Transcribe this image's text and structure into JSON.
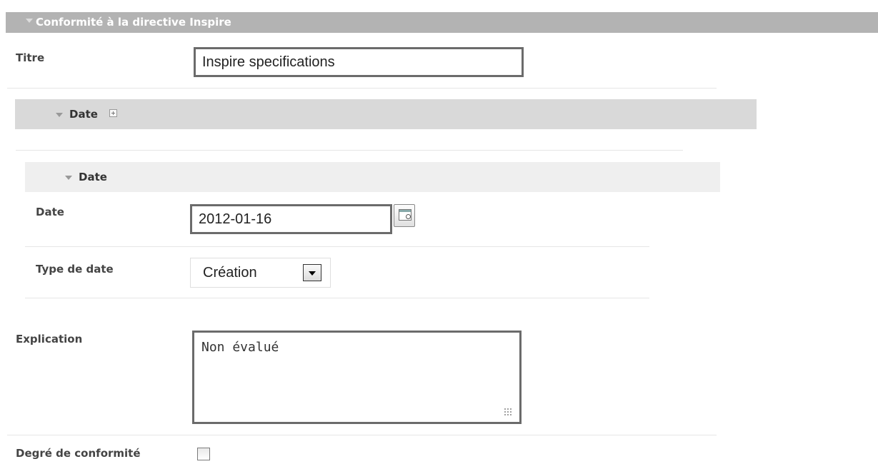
{
  "section": {
    "title": "Conformité à la directive Inspire"
  },
  "fields": {
    "titre": {
      "label": "Titre",
      "value": "Inspire specifications"
    },
    "date_group": {
      "label": "Date"
    },
    "date_item": {
      "label": "Date"
    },
    "date": {
      "label": "Date",
      "value": "2012-01-16"
    },
    "type_de_date": {
      "label": "Type de date",
      "value": "Création"
    },
    "explication": {
      "label": "Explication",
      "value": "Non évalué"
    },
    "degre": {
      "label": "Degré de conformité",
      "checked": false
    }
  },
  "colors": {
    "section_bar": "#b3b3b3",
    "subsection_bar": "#d9d9d9",
    "subsection_bar_light": "#efefef",
    "input_border": "#6b6b6b"
  },
  "icons": {
    "collapse": "triangle-down-icon",
    "add": "plus-box-icon",
    "calendar": "calendar-icon",
    "dropdown": "chevron-down-icon",
    "resize": "resize-grip-icon"
  }
}
